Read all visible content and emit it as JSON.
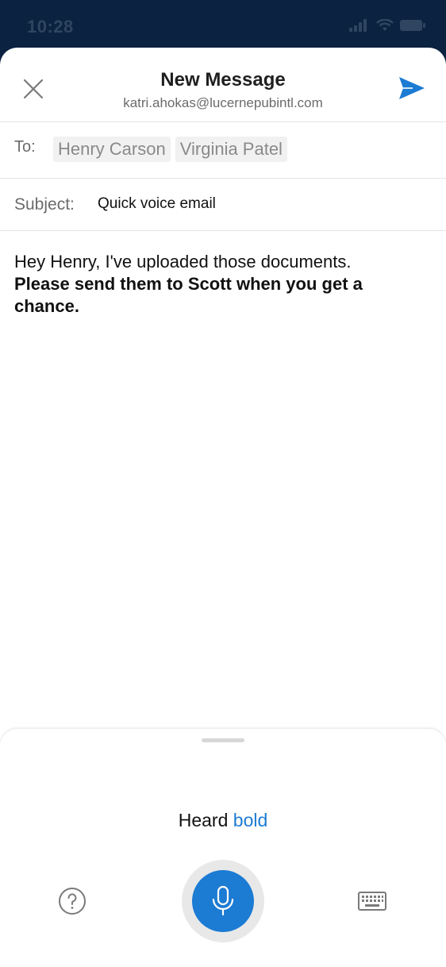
{
  "status_bar": {
    "time": "10:28"
  },
  "header": {
    "title": "New Message",
    "account": "katri.ahokas@lucernepubintl.com",
    "accent_color": "#1c7bd3"
  },
  "to": {
    "label": "To:",
    "recipients": [
      "Henry Carson",
      "Virginia Patel"
    ]
  },
  "subject": {
    "label": "Subject:",
    "value": "Quick voice email"
  },
  "body": {
    "plain_text": "Hey Henry, I've uploaded those documents.",
    "bold_text": "Please send them to Scott when you get a chance."
  },
  "voice": {
    "heard_prefix": "Heard",
    "heard_command": "bold"
  },
  "icons": {
    "close": "close-icon",
    "send": "send-icon",
    "help": "help-icon",
    "mic": "microphone-icon",
    "keyboard": "keyboard-icon"
  }
}
